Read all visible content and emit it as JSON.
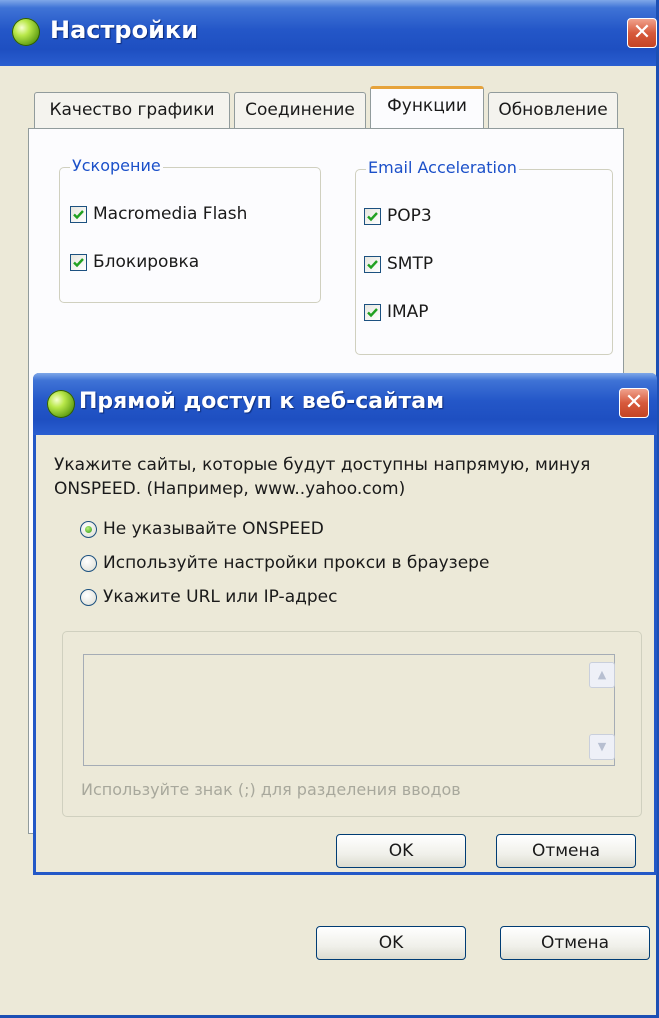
{
  "main_window": {
    "title": "Настройки",
    "close_glyph": "✕",
    "tabs": [
      {
        "label": "Качество графики",
        "active": false
      },
      {
        "label": "Соединение",
        "active": false
      },
      {
        "label": "Функции",
        "active": true
      },
      {
        "label": "Обновление",
        "active": false
      }
    ],
    "acceleration_group": {
      "legend": "Ускорение",
      "items": [
        {
          "label": "Macromedia Flash",
          "checked": true
        },
        {
          "label": "Блокировка",
          "checked": true
        }
      ]
    },
    "email_group": {
      "legend": "Email Acceleration",
      "items": [
        {
          "label": "POP3",
          "checked": true
        },
        {
          "label": "SMTP",
          "checked": true
        },
        {
          "label": "IMAP",
          "checked": true
        }
      ]
    },
    "ok_label": "OK",
    "cancel_label": "Отмена"
  },
  "dialog": {
    "title": "Прямой доступ к веб-сайтам",
    "close_glyph": "✕",
    "description": "Укажите сайты, которые будут доступны напрямую, минуя ONSPEED. (Например, www..yahoo.com)",
    "options": [
      {
        "label": "Не указывайте ONSPEED",
        "selected": true
      },
      {
        "label": "Используйте настройки прокси в браузере",
        "selected": false
      },
      {
        "label": "Укажите URL или IP-адрес",
        "selected": false
      }
    ],
    "textarea_value": "",
    "hint": "Используйте знак (;) для разделения вводов",
    "ok_label": "OK",
    "cancel_label": "Отмена"
  },
  "colors": {
    "titlebar": "#2457c8",
    "accent_tab": "#e6a33b",
    "legend_text": "#1b50c9",
    "close_button": "#d75a3c"
  },
  "icons": {
    "app_icon": "green-orb-icon",
    "close": "close-icon",
    "check": "checkmark-icon",
    "scroll_up": "chevron-up-icon",
    "scroll_down": "chevron-down-icon"
  }
}
